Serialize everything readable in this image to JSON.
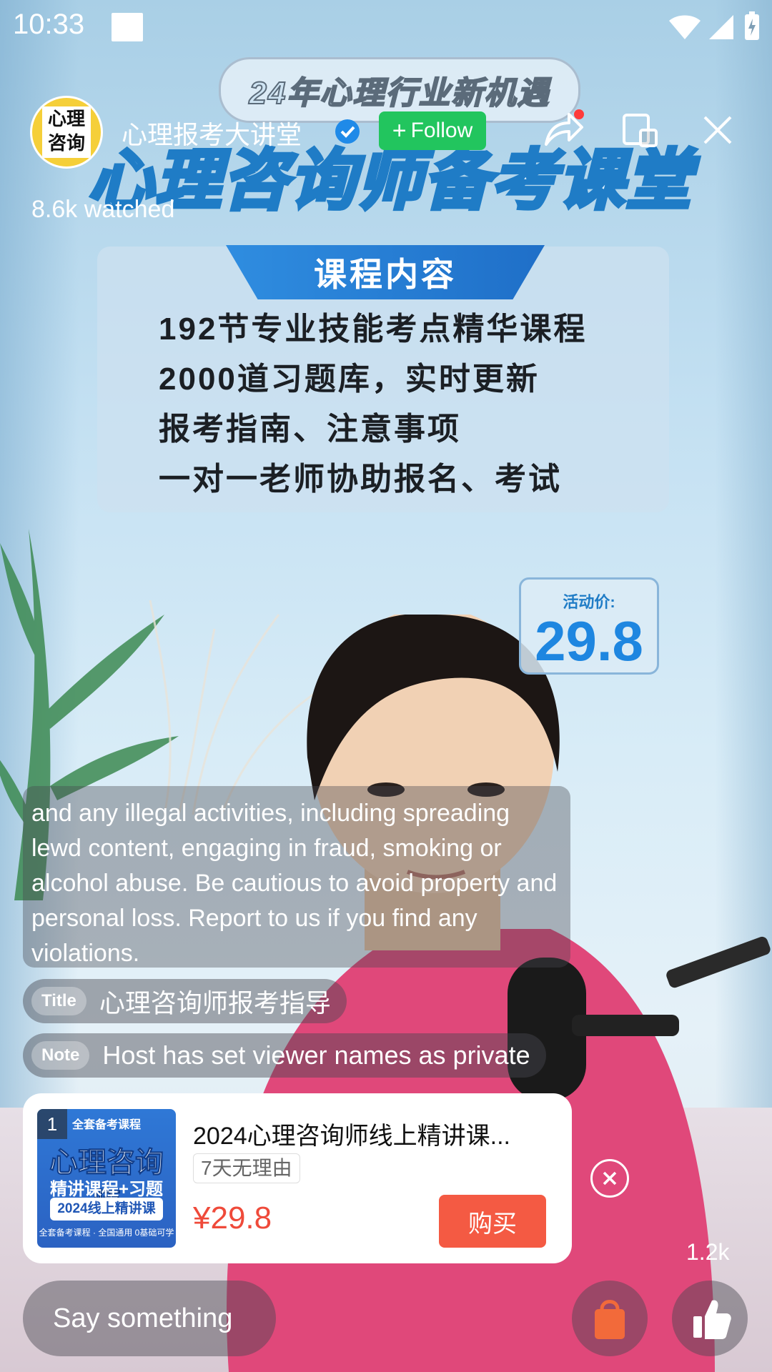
{
  "status_bar": {
    "time": "10:33"
  },
  "header": {
    "streamer_name": "心理报考大讲堂",
    "follow_label": "Follow",
    "watched": "8.6k watched",
    "avatar_text_line1": "心理",
    "avatar_text_line2": "咨询"
  },
  "banner": {
    "top_pill": "24年心理行业新机遇",
    "main_title": "心理咨询师备考课堂",
    "course_tab": "课程内容",
    "course_lines": [
      "192节专业技能考点精华课程",
      "2000道习题库，实时更新",
      "报考指南、注意事项",
      "一对一老师协助报名、考试"
    ],
    "price_label": "活动价:",
    "price_value": "29.8"
  },
  "chat": {
    "notice_text": "and any illegal activities, including spreading lewd content, engaging in fraud, smoking or alcohol abuse. Be cautious to avoid property and personal loss. Report to us if you find any violations.",
    "title_tag": "Title",
    "title_text": "心理咨询师报考指导",
    "note_tag": "Note",
    "note_text": "Host has set viewer names as private"
  },
  "product": {
    "index": "1",
    "title": "2024心理咨询师线上精讲课...",
    "tag": "7天无理由",
    "price": "¥29.8",
    "buy_label": "购买",
    "image_text": {
      "top": "全套备考课程",
      "main": "心理咨询师",
      "sub": "精讲课程+习题",
      "year": "2024线上精讲课",
      "bottom": "全套备考课程 · 全国通用 0基础可学"
    }
  },
  "bottom": {
    "like_count": "1.2k",
    "input_placeholder": "Say something"
  },
  "colors": {
    "follow": "#22c55e",
    "buy": "#f45a43",
    "price": "#ef4a3a",
    "accent_blue": "#1f7cc6",
    "bag": "#f26a3a"
  }
}
